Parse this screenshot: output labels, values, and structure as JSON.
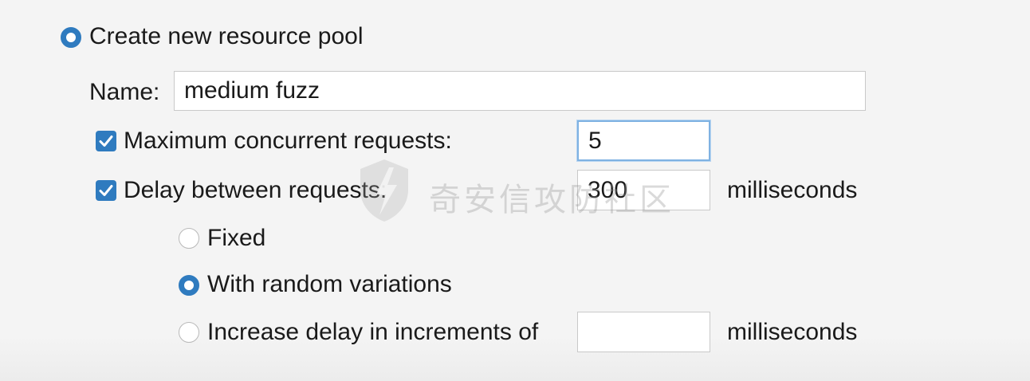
{
  "pool": {
    "create_label": "Create new resource pool",
    "name_label": "Name:",
    "name_value": "medium fuzz"
  },
  "max_concurrent": {
    "label": "Maximum concurrent requests:",
    "value": "5",
    "checked": true
  },
  "delay": {
    "label": "Delay between requests:",
    "value": "300",
    "unit": "milliseconds",
    "checked": true,
    "options": {
      "fixed": "Fixed",
      "random": "With random variations",
      "increase": "Increase delay in increments of"
    },
    "increment_value": "",
    "increment_unit": "milliseconds",
    "selected_option": "random"
  },
  "watermark": "奇安信攻防社区",
  "colors": {
    "accent": "#2f7bbf",
    "focus_border": "#7fb2e2"
  }
}
